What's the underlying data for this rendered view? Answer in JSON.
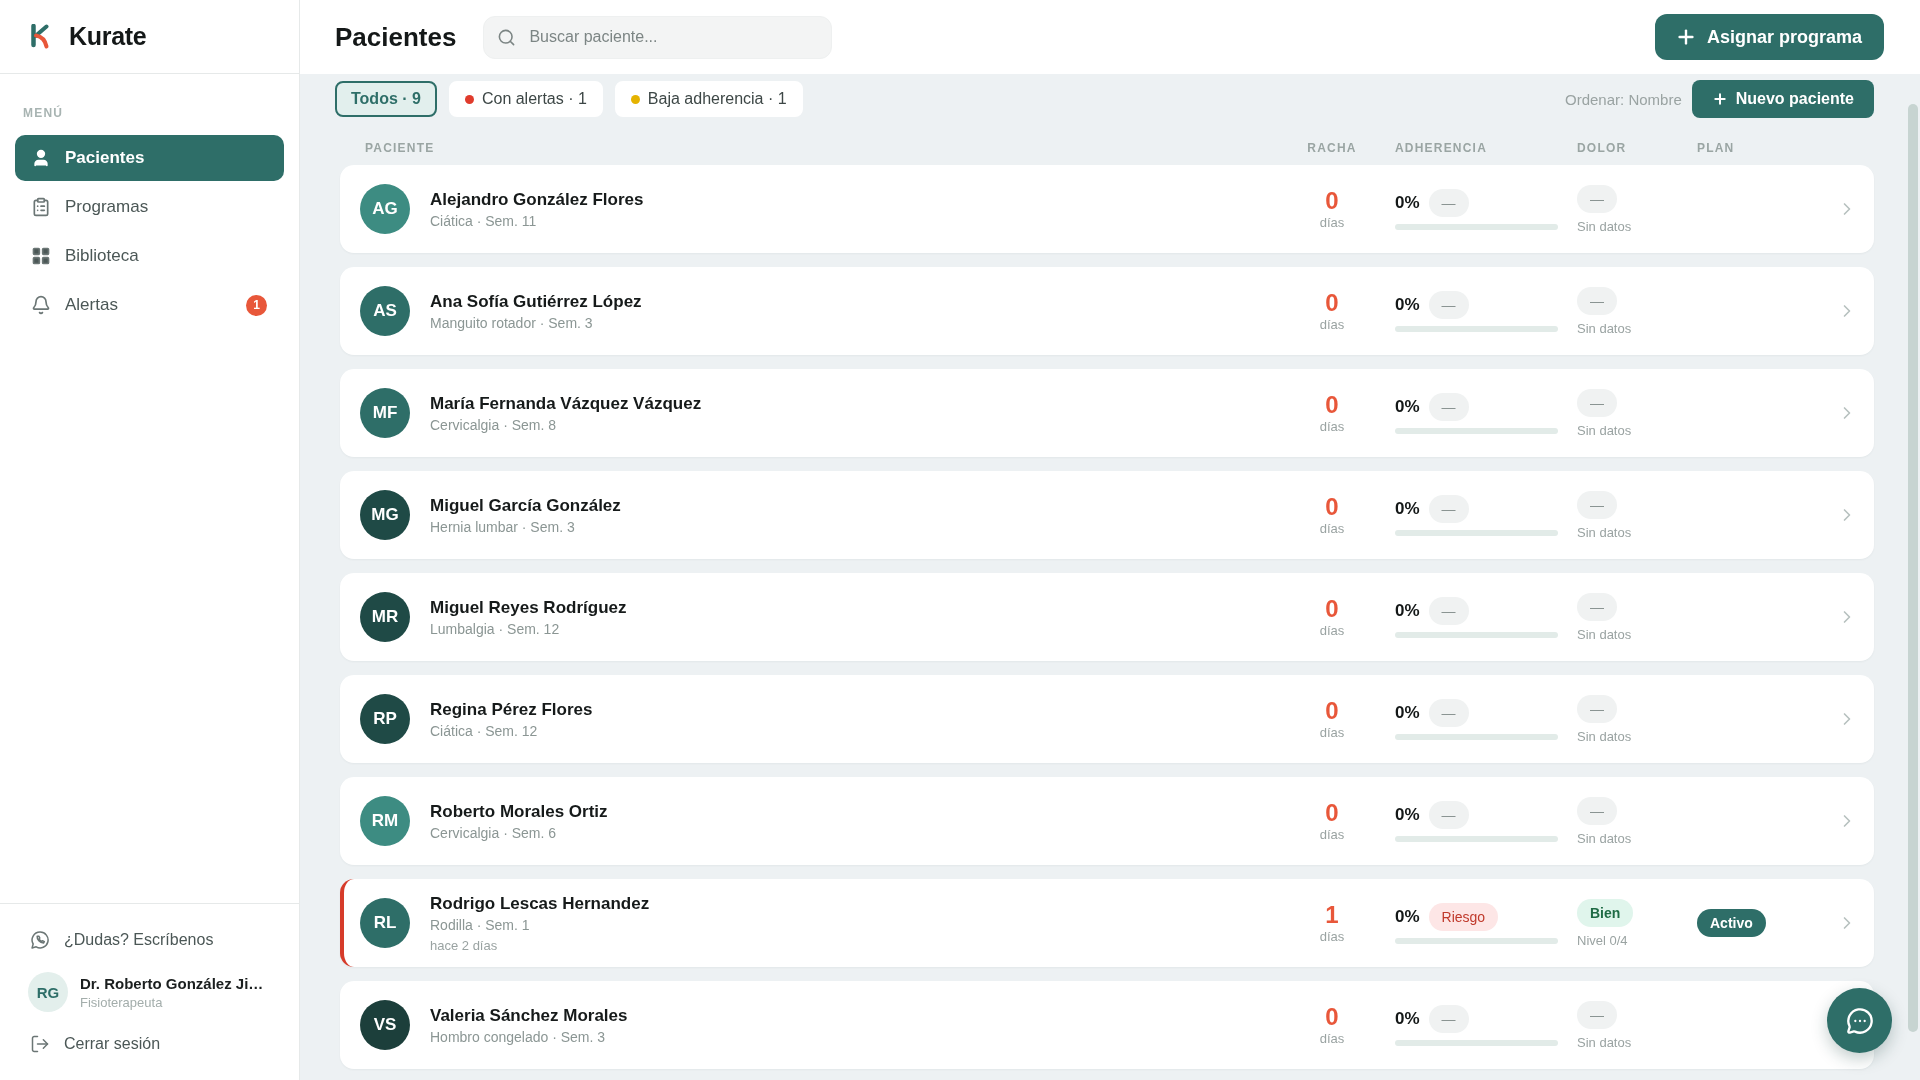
{
  "sidebar": {
    "brand": "Kurate",
    "menu_label": "MENÚ",
    "items": [
      {
        "label": "Pacientes",
        "kind": "person",
        "selected": true
      },
      {
        "label": "Programas",
        "kind": "clipboard",
        "selected": false
      },
      {
        "label": "Biblioteca",
        "kind": "grid",
        "selected": false
      },
      {
        "label": "Alertas",
        "kind": "bell",
        "selected": false,
        "badge": "1"
      }
    ],
    "help_link": "¿Dudas? Escríbenos",
    "user": {
      "initials": "RG",
      "name": "Dr. Roberto González Ji…",
      "role": "Fisioterapeuta"
    },
    "logout": "Cerrar sesión"
  },
  "header": {
    "title": "Pacientes",
    "search": {
      "placeholder": "Buscar paciente..."
    },
    "primary_button": "Asignar programa"
  },
  "filters": [
    {
      "label": "Todos · 9",
      "selected": true
    },
    {
      "label": "Con alertas · 1",
      "selected": false,
      "color": "#e03b2c"
    },
    {
      "label": "Baja adherencia · 1",
      "selected": false,
      "color": "#e5b300"
    }
  ],
  "sort_label": "Ordenar: Nombre",
  "new_button": "Nuevo paciente",
  "table": {
    "columns": [
      "PACIENTE",
      "RACHA",
      "ADHERENCIA",
      "DOLOR",
      "PLAN"
    ],
    "rows": [
      {
        "initials": "AG",
        "color": "#3d8c82",
        "name": "Alejandro González Flores",
        "detail": "Ciática · Sem. 11",
        "alert": false,
        "streak": "0",
        "streak_unit": "días",
        "adherence": {
          "value": "0%",
          "level": 0,
          "badge": {
            "kind": "neutral",
            "label": "—"
          }
        },
        "pain": {
          "badge": {
            "kind": "neutral",
            "label": "—"
          },
          "note": "Sin datos"
        }
      },
      {
        "initials": "AS",
        "color": "#2e6e68",
        "name": "Ana Sofía Gutiérrez López",
        "detail": "Manguito rotador · Sem. 3",
        "alert": false,
        "streak": "0",
        "streak_unit": "días",
        "adherence": {
          "value": "0%",
          "level": 0,
          "badge": {
            "kind": "neutral",
            "label": "—"
          }
        },
        "pain": {
          "badge": {
            "kind": "neutral",
            "label": "—"
          },
          "note": "Sin datos"
        }
      },
      {
        "initials": "MF",
        "color": "#2e6e68",
        "name": "María Fernanda Vázquez Vázquez",
        "detail": "Cervicalgia · Sem. 8",
        "alert": false,
        "streak": "0",
        "streak_unit": "días",
        "adherence": {
          "value": "0%",
          "level": 0,
          "badge": {
            "kind": "neutral",
            "label": "—"
          }
        },
        "pain": {
          "badge": {
            "kind": "neutral",
            "label": "—"
          },
          "note": "Sin datos"
        }
      },
      {
        "initials": "MG",
        "color": "#1f4a46",
        "name": "Miguel García González",
        "detail": "Hernia lumbar · Sem. 3",
        "alert": false,
        "streak": "0",
        "streak_unit": "días",
        "adherence": {
          "value": "0%",
          "level": 0,
          "badge": {
            "kind": "neutral",
            "label": "—"
          }
        },
        "pain": {
          "badge": {
            "kind": "neutral",
            "label": "—"
          },
          "note": "Sin datos"
        }
      },
      {
        "initials": "MR",
        "color": "#1f4a46",
        "name": "Miguel Reyes Rodríguez",
        "detail": "Lumbalgia · Sem. 12",
        "alert": false,
        "streak": "0",
        "streak_unit": "días",
        "adherence": {
          "value": "0%",
          "level": 0,
          "badge": {
            "kind": "neutral",
            "label": "—"
          }
        },
        "pain": {
          "badge": {
            "kind": "neutral",
            "label": "—"
          },
          "note": "Sin datos"
        }
      },
      {
        "initials": "RP",
        "color": "#1f4a46",
        "name": "Regina Pérez Flores",
        "detail": "Ciática · Sem. 12",
        "alert": false,
        "streak": "0",
        "streak_unit": "días",
        "adherence": {
          "value": "0%",
          "level": 0,
          "badge": {
            "kind": "neutral",
            "label": "—"
          }
        },
        "pain": {
          "badge": {
            "kind": "neutral",
            "label": "—"
          },
          "note": "Sin datos"
        }
      },
      {
        "initials": "RM",
        "color": "#3d8c82",
        "name": "Roberto Morales Ortiz",
        "detail": "Cervicalgia · Sem. 6",
        "alert": false,
        "streak": "0",
        "streak_unit": "días",
        "adherence": {
          "value": "0%",
          "level": 0,
          "badge": {
            "kind": "neutral",
            "label": "—"
          }
        },
        "pain": {
          "badge": {
            "kind": "neutral",
            "label": "—"
          },
          "note": "Sin datos"
        }
      },
      {
        "initials": "RL",
        "color": "#2e6e68",
        "name": "Rodrigo Lescas Hernandez",
        "detail": "Rodilla · Sem. 1",
        "last_activity": "hace 2 días",
        "alert": true,
        "streak": "1",
        "streak_unit": "días",
        "adherence": {
          "value": "0%",
          "level": 0,
          "badge": {
            "kind": "risk",
            "label": "Riesgo"
          }
        },
        "pain": {
          "badge": {
            "kind": "good",
            "label": "Bien"
          },
          "note": "Nivel 0/4"
        },
        "plan": {
          "kind": "active",
          "label": "Activo"
        }
      },
      {
        "initials": "VS",
        "color": "#1c3f3b",
        "name": "Valeria Sánchez Morales",
        "detail": "Hombro congelado · Sem. 3",
        "alert": false,
        "streak": "0",
        "streak_unit": "días",
        "adherence": {
          "value": "0%",
          "level": 0,
          "badge": {
            "kind": "neutral",
            "label": "—"
          }
        },
        "pain": {
          "badge": {
            "kind": "neutral",
            "label": "—"
          },
          "note": "Sin datos"
        }
      }
    ]
  }
}
